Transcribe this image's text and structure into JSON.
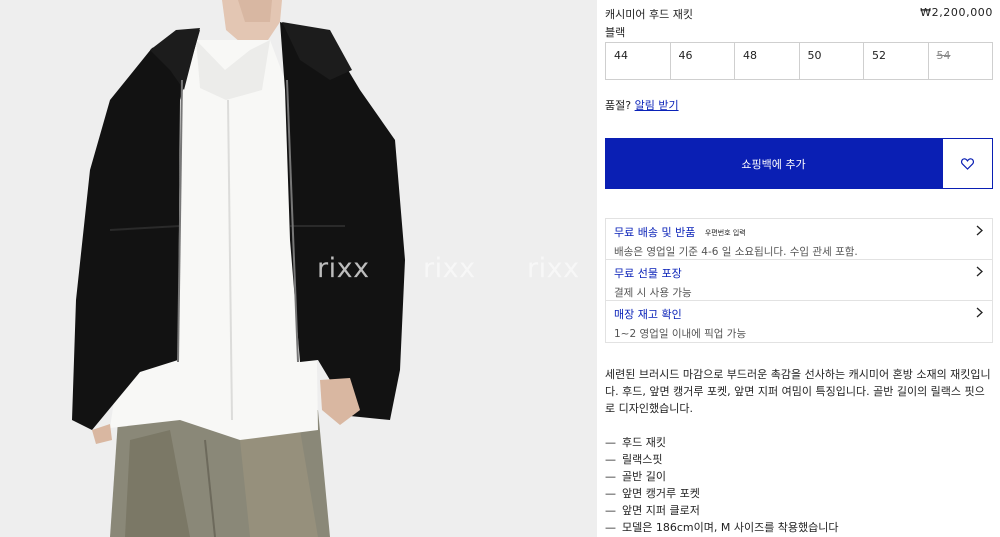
{
  "product": {
    "name": "캐시미어 후드 재킷",
    "price": "₩2,200,000",
    "color": "블랙"
  },
  "sizes": [
    {
      "label": "44",
      "available": true
    },
    {
      "label": "46",
      "available": true
    },
    {
      "label": "48",
      "available": true
    },
    {
      "label": "50",
      "available": true
    },
    {
      "label": "52",
      "available": true
    },
    {
      "label": "54",
      "available": false
    }
  ],
  "fit": {
    "question": "품절?",
    "link": "알림 받기"
  },
  "cart": {
    "add_label": "쇼핑백에 추가",
    "wishlist_icon": "heart-icon"
  },
  "info": [
    {
      "title": "무료 배송 및 반품",
      "note": "우편번호 입력",
      "sub": "배송은 영업일 기준 4-6 일 소요됩니다. 수입 관세 포함."
    },
    {
      "title": "무료 선물 포장",
      "note": "",
      "sub": "결제 시 사용 가능"
    },
    {
      "title": "매장 재고 확인",
      "note": "",
      "sub": "1~2 영업일 이내에 픽업 가능"
    }
  ],
  "description": "세련된 브러시드 마감으로 부드러운 촉감을 선사하는 캐시미어 혼방 소재의 재킷입니다. 후드, 앞면 캥거루 포켓, 앞면 지퍼 여밈이 특징입니다. 골반 길이의 릴랙스 핏으로 디자인했습니다.",
  "features": [
    "후드 재킷",
    "릴랙스핏",
    "골반 길이",
    "앞면 캥거루 포켓",
    "앞면 지퍼 클로저",
    "모델은 186cm이며, M 사이즈를 착용했습니다"
  ],
  "watermarks": [
    "rixx",
    "rixx",
    "rixx"
  ],
  "colors": {
    "accent": "#0a1fb4",
    "link": "#0a22b8",
    "photo_bg": "#eeeeee"
  }
}
